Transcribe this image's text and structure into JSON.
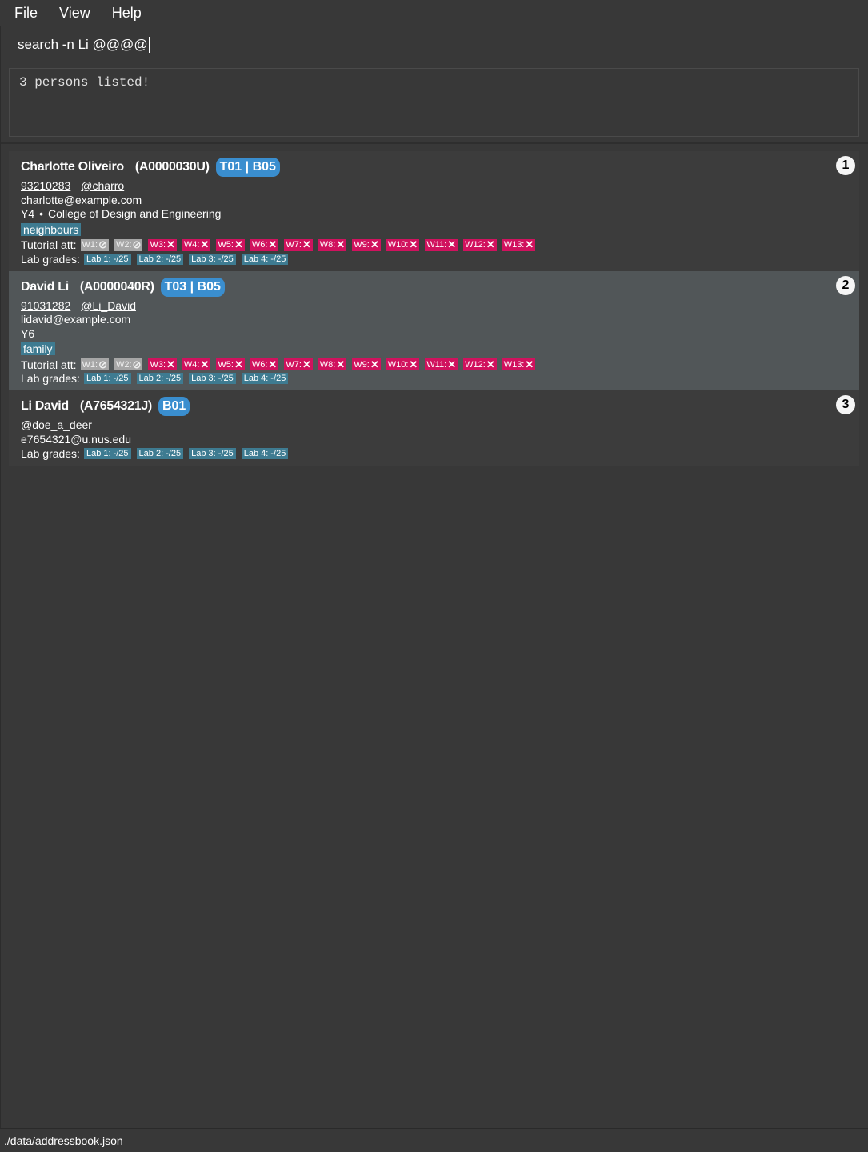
{
  "menu": {
    "items": [
      "File",
      "View",
      "Help"
    ]
  },
  "command": {
    "value": "search -n Li @@@@"
  },
  "result": {
    "text": "3 persons listed!"
  },
  "persons": [
    {
      "index": "1",
      "name": "Charlotte Oliveiro",
      "student_id": "(A0000030U)",
      "group": "T01 | B05",
      "phone": "93210283",
      "telegram": "@charro",
      "email": "charlotte@example.com",
      "year": "Y4",
      "faculty": "College of Design and Engineering",
      "tag": "neighbours",
      "attendance": [
        {
          "label": "W1:",
          "status": "na"
        },
        {
          "label": "W2:",
          "status": "na"
        },
        {
          "label": "W3:",
          "status": "absent"
        },
        {
          "label": "W4:",
          "status": "absent"
        },
        {
          "label": "W5:",
          "status": "absent"
        },
        {
          "label": "W6:",
          "status": "absent"
        },
        {
          "label": "W7:",
          "status": "absent"
        },
        {
          "label": "W8:",
          "status": "absent"
        },
        {
          "label": "W9:",
          "status": "absent"
        },
        {
          "label": "W10:",
          "status": "absent"
        },
        {
          "label": "W11:",
          "status": "absent"
        },
        {
          "label": "W12:",
          "status": "absent"
        },
        {
          "label": "W13:",
          "status": "absent"
        }
      ],
      "labs": [
        "Lab 1: -/25",
        "Lab 2: -/25",
        "Lab 3: -/25",
        "Lab 4: -/25"
      ]
    },
    {
      "index": "2",
      "name": "David Li",
      "student_id": "(A0000040R)",
      "group": "T03 | B05",
      "phone": "91031282",
      "telegram": "@Li_David",
      "email": "lidavid@example.com",
      "year": "Y6",
      "faculty": "",
      "tag": "family",
      "attendance": [
        {
          "label": "W1:",
          "status": "na"
        },
        {
          "label": "W2:",
          "status": "na"
        },
        {
          "label": "W3:",
          "status": "absent"
        },
        {
          "label": "W4:",
          "status": "absent"
        },
        {
          "label": "W5:",
          "status": "absent"
        },
        {
          "label": "W6:",
          "status": "absent"
        },
        {
          "label": "W7:",
          "status": "absent"
        },
        {
          "label": "W8:",
          "status": "absent"
        },
        {
          "label": "W9:",
          "status": "absent"
        },
        {
          "label": "W10:",
          "status": "absent"
        },
        {
          "label": "W11:",
          "status": "absent"
        },
        {
          "label": "W12:",
          "status": "absent"
        },
        {
          "label": "W13:",
          "status": "absent"
        }
      ],
      "labs": [
        "Lab 1: -/25",
        "Lab 2: -/25",
        "Lab 3: -/25",
        "Lab 4: -/25"
      ]
    },
    {
      "index": "3",
      "name": "Li David",
      "student_id": "(A7654321J)",
      "group": "B01",
      "telegram": "@doe_a_deer",
      "email": "e7654321@u.nus.edu",
      "labs": [
        "Lab 1: -/25",
        "Lab 2: -/25",
        "Lab 3: -/25",
        "Lab 4: -/25"
      ]
    }
  ],
  "labels": {
    "tutorial_att": "Tutorial att:",
    "lab_grades": "Lab grades:",
    "separator": "•"
  },
  "icons": {
    "na": "circle-slash-icon",
    "absent": "x-icon"
  },
  "colors": {
    "absent": "#d0125e",
    "na": "#a6a6a6",
    "group_badge": "#3a8ecf",
    "tag": "#3e7b91"
  },
  "status": {
    "file_path": "./data/addressbook.json"
  }
}
